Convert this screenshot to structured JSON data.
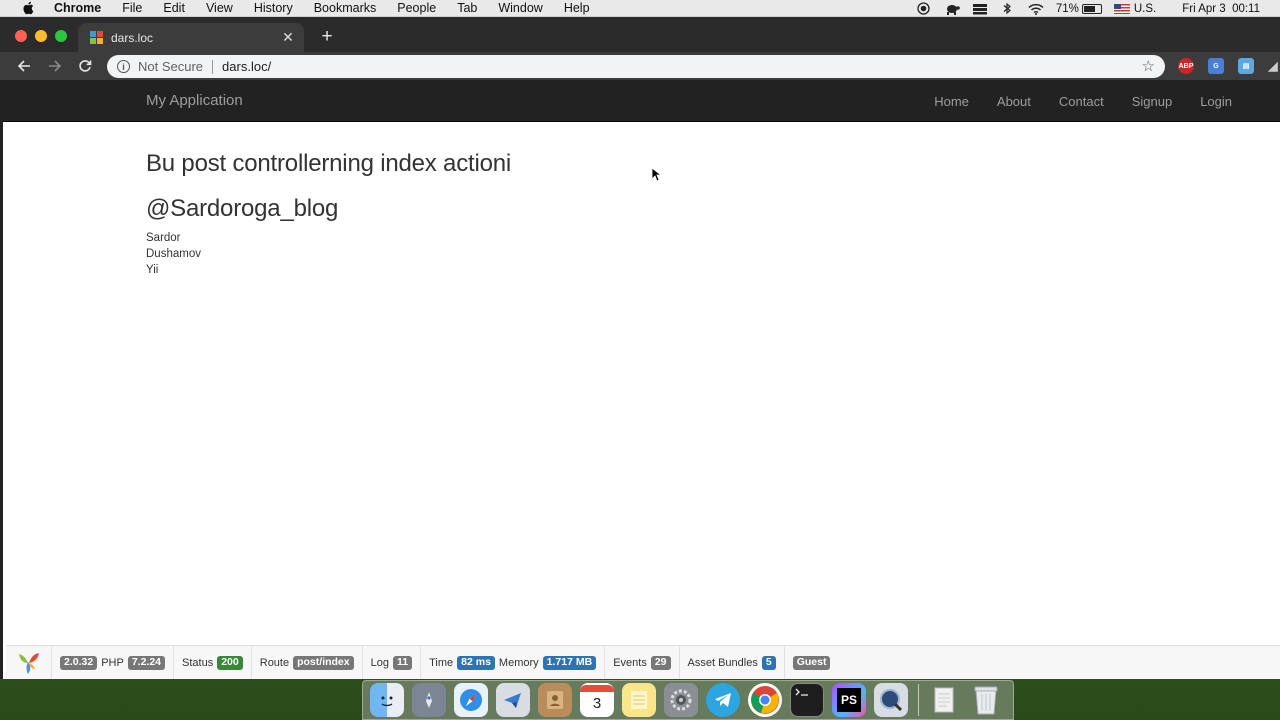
{
  "menubar": {
    "app_name": "Chrome",
    "items": [
      "File",
      "Edit",
      "View",
      "History",
      "Bookmarks",
      "People",
      "Tab",
      "Window",
      "Help"
    ],
    "status": {
      "battery_percent": "71%",
      "battery_level": 0.71,
      "input_source": "U.S.",
      "clock": "Fri Apr 3  00:11"
    }
  },
  "browser": {
    "tab_title": "dars.loc",
    "omnibox": {
      "security_label": "Not Secure",
      "url": "dars.loc/"
    },
    "extensions": [
      "abp-icon",
      "translate-icon",
      "extension-icon"
    ]
  },
  "site": {
    "brand": "My Application",
    "nav": [
      "Home",
      "About",
      "Contact",
      "Signup",
      "Login"
    ],
    "heading_1": "Bu post controllerning index actioni",
    "heading_2": "@Sardoroga_blog",
    "lines": [
      "Sardor",
      "Dushamov",
      "Yii"
    ]
  },
  "debug_toolbar": {
    "yii_version": "2.0.32",
    "php_label": "PHP",
    "php_version": "7.2.24",
    "status_label": "Status",
    "status_code": "200",
    "route_label": "Route",
    "route": "post/index",
    "log_label": "Log",
    "log_count": "11",
    "time_label": "Time",
    "time_value": "82 ms",
    "memory_label": "Memory",
    "memory_value": "1.717 MB",
    "events_label": "Events",
    "events_count": "29",
    "asset_label": "Asset Bundles",
    "asset_count": "5",
    "user": "Guest"
  },
  "dock": {
    "apps": [
      "finder-icon",
      "launchpad-icon",
      "safari-icon",
      "mail-icon",
      "contacts-icon",
      "calendar-icon",
      "notes-icon",
      "system-preferences-icon",
      "telegram-icon",
      "chrome-icon",
      "terminal-icon",
      "phpstorm-icon",
      "quicktime-icon",
      "documents-icon",
      "trash-icon"
    ],
    "calendar_day": "3",
    "phpstorm_label": "PS"
  },
  "colors": {
    "navbar_bg": "#222222",
    "navbar_text": "#9d9d9d",
    "label_success": "#3a873a",
    "label_info": "#2d74b4",
    "label_default": "#777777"
  }
}
